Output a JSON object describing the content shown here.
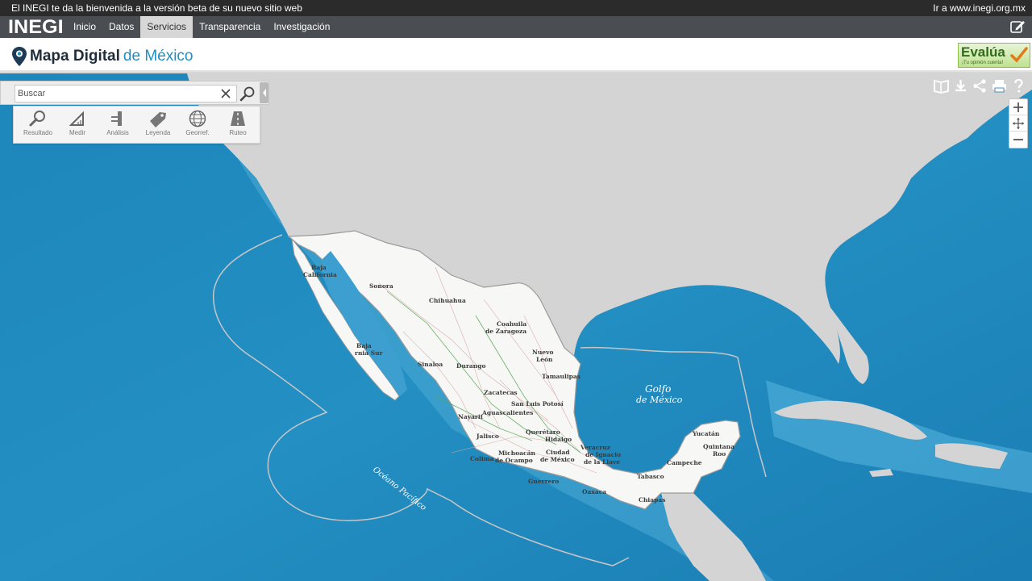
{
  "topbar": {
    "message": "El INEGI te da la bienvenida a la versión beta de su nuevo sitio web",
    "link": "Ir a www.inegi.org.mx"
  },
  "nav": {
    "logo": "INEGI",
    "items": [
      {
        "label": "Inicio"
      },
      {
        "label": "Datos"
      },
      {
        "label": "Servicios"
      },
      {
        "label": "Transparencia"
      },
      {
        "label": "Investigación"
      }
    ],
    "active": "Servicios",
    "edit_icon": "edit-icon"
  },
  "header": {
    "title_bold": "Mapa Digital",
    "title_light": "de México",
    "evalua_label": "Evalúa",
    "evalua_sub": "¡Tu opinión cuenta!"
  },
  "search": {
    "placeholder": "Buscar",
    "clear_icon": "close-icon",
    "search_icon": "search-icon"
  },
  "tools": [
    {
      "label": "Resultado",
      "icon": "magnifier-icon"
    },
    {
      "label": "Medir",
      "icon": "ruler-triangle-icon"
    },
    {
      "label": "Análisis",
      "icon": "analysis-icon"
    },
    {
      "label": "Leyenda",
      "icon": "tag-icon"
    },
    {
      "label": "Georref.",
      "icon": "globe-icon"
    },
    {
      "label": "Ruteo",
      "icon": "road-icon"
    }
  ],
  "map_tools": [
    "map-layers-icon",
    "download-icon",
    "share-icon",
    "print-icon",
    "help-icon"
  ],
  "zoom": [
    "zoom-in-icon",
    "pan-icon",
    "zoom-out-icon"
  ],
  "map": {
    "colors": {
      "ocean": "#1e8cc0",
      "land": "#d4d4d4",
      "mexico": "#f7f7f5",
      "boundary": "#c0c0c0"
    },
    "sea_labels": {
      "gulf": [
        "Golfo",
        "de México"
      ],
      "pacific": "Océano Pacífico"
    },
    "states": [
      {
        "name": "Baja",
        "name2": "California"
      },
      {
        "name": "Sonora"
      },
      {
        "name": "Chihuahua"
      },
      {
        "name": "Coahuila",
        "name2": "de Zaragoza"
      },
      {
        "name": "Nuevo",
        "name2": "León"
      },
      {
        "name": "Tamaulipas"
      },
      {
        "name": "Baja",
        "name2": "rnia Sur"
      },
      {
        "name": "Sinaloa"
      },
      {
        "name": "Durango"
      },
      {
        "name": "Zacatecas"
      },
      {
        "name": "San Luis Potosí"
      },
      {
        "name": "Aguascalientes"
      },
      {
        "name": "Nayarit"
      },
      {
        "name": "Jalisco"
      },
      {
        "name": "Querétaro"
      },
      {
        "name": "Hidalgo"
      },
      {
        "name": "Colima"
      },
      {
        "name": "Michoacán",
        "name2": "de Ocampo"
      },
      {
        "name": "Ciudad",
        "name2": "de México"
      },
      {
        "name": "Veracruz",
        "name2": "de Ignacio",
        "name3": "de la Llave"
      },
      {
        "name": "Guerrero"
      },
      {
        "name": "Oaxaca"
      },
      {
        "name": "Tabasco"
      },
      {
        "name": "Campeche"
      },
      {
        "name": "Yucatán"
      },
      {
        "name": "Quintana",
        "name2": "Roo"
      },
      {
        "name": "Chiapas"
      }
    ]
  }
}
